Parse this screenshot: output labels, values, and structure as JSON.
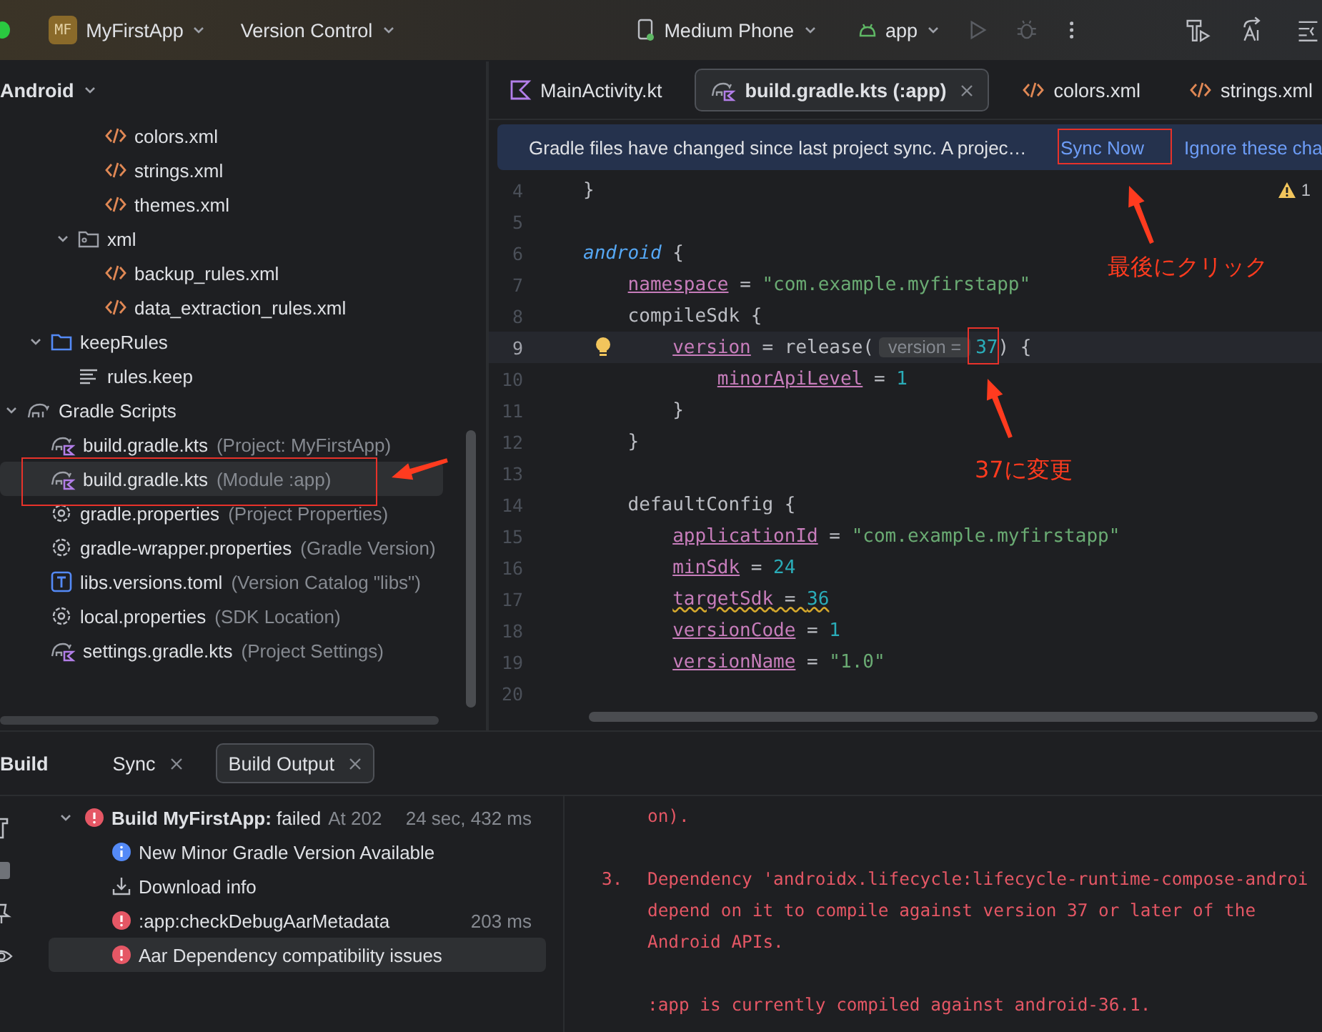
{
  "title_bar": {
    "project_badge": "MF",
    "project": "MyFirstApp",
    "vcs": "Version Control",
    "device": "Medium Phone",
    "config": "app"
  },
  "project_panel": {
    "view": "Android",
    "tree": [
      {
        "children": [
          {
            "children": [
              {
                "children": [
                  {
                    "label": "colors.xml",
                    "kind": "xml",
                    "selected": false
                  },
                  {
                    "label": "strings.xml",
                    "kind": "xml",
                    "selected": false
                  },
                  {
                    "label": "themes.xml",
                    "kind": "xml",
                    "selected": false
                  }
                ]
              },
              {
                "label": "xml",
                "kind": "res_folder",
                "expanded": true,
                "selected": false,
                "children": [
                  {
                    "label": "backup_rules.xml",
                    "kind": "xml",
                    "selected": false
                  },
                  {
                    "label": "data_extraction_rules.xml",
                    "kind": "xml",
                    "selected": false
                  }
                ]
              }
            ]
          },
          {
            "label": "keepRules",
            "kind": "folder",
            "expanded": true,
            "selected": false,
            "children": [
              {
                "label": "rules.keep",
                "kind": "text",
                "selected": false
              }
            ]
          }
        ]
      },
      {
        "label": "Gradle Scripts",
        "kind": "gradle",
        "expanded": true,
        "selected": false,
        "children": [
          {
            "label": "build.gradle.kts",
            "detail": "(Project: MyFirstApp)",
            "kind": "gradle_kts",
            "selected": false
          },
          {
            "label": "build.gradle.kts",
            "detail": "(Module :app)",
            "kind": "gradle_kts",
            "selected": true
          },
          {
            "label": "gradle.properties",
            "detail": "(Project Properties)",
            "kind": "settings",
            "selected": false
          },
          {
            "label": "gradle-wrapper.properties",
            "detail": "(Gradle Version)",
            "kind": "settings",
            "selected": false
          },
          {
            "label": "libs.versions.toml",
            "detail": "(Version Catalog \"libs\")",
            "kind": "toml",
            "selected": false
          },
          {
            "label": "local.properties",
            "detail": "(SDK Location)",
            "kind": "settings",
            "selected": false
          },
          {
            "label": "settings.gradle.kts",
            "detail": "(Project Settings)",
            "kind": "gradle_kts",
            "selected": false
          }
        ]
      }
    ]
  },
  "editor": {
    "tabs": [
      {
        "label": "MainActivity.kt",
        "kind": "kotlin",
        "selected": false
      },
      {
        "label": "build.gradle.kts (:app)",
        "kind": "gradle_kts",
        "selected": true
      },
      {
        "label": "colors.xml",
        "kind": "xml",
        "selected": false
      },
      {
        "label": "strings.xml",
        "kind": "xml",
        "selected": false
      }
    ],
    "banner": {
      "message": "Gradle files have changed since last project sync. A projec…",
      "actions": [
        "Sync Now",
        "Ignore these cha"
      ]
    },
    "warnings": "1",
    "lines": [
      {
        "number": "4",
        "current": false,
        "tokens": [
          {
            "kind": "plain",
            "text": "}"
          }
        ]
      },
      {
        "number": "5",
        "current": false
      },
      {
        "number": "6",
        "current": false,
        "tokens": [
          {
            "kind": "keyword",
            "text": "android"
          },
          {
            "kind": "plain",
            "text": " {"
          }
        ],
        "children": [
          {
            "number": "7",
            "current": false,
            "tokens": [
              {
                "kind": "prop",
                "text": "namespace"
              },
              {
                "kind": "plain",
                "text": " = "
              },
              {
                "kind": "string",
                "text": "\"com.example.myfirstapp\""
              }
            ]
          },
          {
            "number": "8",
            "current": false,
            "tokens": [
              {
                "kind": "plain",
                "text": "compileSdk {"
              }
            ],
            "children": [
              {
                "number": "9",
                "current": true,
                "tokens": [
                  {
                    "kind": "prop",
                    "text": "version"
                  },
                  {
                    "kind": "plain",
                    "text": " = release("
                  },
                  {
                    "kind": "hint",
                    "text": "version ="
                  },
                  {
                    "kind": "number",
                    "text": "37"
                  },
                  {
                    "kind": "plain",
                    "text": ") {"
                  }
                ],
                "children": [
                  {
                    "number": "10",
                    "current": false,
                    "tokens": [
                      {
                        "kind": "prop",
                        "text": "minorApiLevel"
                      },
                      {
                        "kind": "plain",
                        "text": " = "
                      },
                      {
                        "kind": "number",
                        "text": "1"
                      }
                    ]
                  }
                ]
              },
              {
                "number": "11",
                "current": false,
                "tokens": [
                  {
                    "kind": "plain",
                    "text": "}"
                  }
                ]
              }
            ]
          },
          {
            "number": "12",
            "current": false,
            "tokens": [
              {
                "kind": "plain",
                "text": "}"
              }
            ]
          },
          {
            "number": "13",
            "current": false
          },
          {
            "number": "14",
            "current": false,
            "tokens": [
              {
                "kind": "plain",
                "text": "defaultConfig {"
              }
            ],
            "children": [
              {
                "number": "15",
                "current": false,
                "tokens": [
                  {
                    "kind": "prop",
                    "text": "applicationId"
                  },
                  {
                    "kind": "plain",
                    "text": " = "
                  },
                  {
                    "kind": "string",
                    "text": "\"com.example.myfirstapp\""
                  }
                ]
              },
              {
                "number": "16",
                "current": false,
                "tokens": [
                  {
                    "kind": "prop",
                    "text": "minSdk"
                  },
                  {
                    "kind": "plain",
                    "text": " = "
                  },
                  {
                    "kind": "number",
                    "text": "24"
                  }
                ]
              },
              {
                "number": "17",
                "current": false,
                "tokens": [
                  {
                    "kind": "prop",
                    "text": "targetSdk",
                    "warning": true
                  },
                  {
                    "kind": "plain",
                    "text": " = ",
                    "warning": true
                  },
                  {
                    "kind": "number",
                    "text": "36",
                    "warning": true
                  }
                ]
              },
              {
                "number": "18",
                "current": false,
                "tokens": [
                  {
                    "kind": "prop",
                    "text": "versionCode"
                  },
                  {
                    "kind": "plain",
                    "text": " = "
                  },
                  {
                    "kind": "number",
                    "text": "1"
                  }
                ]
              },
              {
                "number": "19",
                "current": false,
                "tokens": [
                  {
                    "kind": "prop",
                    "text": "versionName"
                  },
                  {
                    "kind": "plain",
                    "text": " = "
                  },
                  {
                    "kind": "string",
                    "text": "\"1.0\""
                  }
                ]
              },
              {
                "number": "20",
                "current": false
              }
            ]
          }
        ]
      }
    ]
  },
  "build_panel": {
    "title": "Build",
    "tabs": [
      {
        "label": "Sync",
        "selected": false
      },
      {
        "label": "Build Output",
        "selected": true
      }
    ],
    "tree": [
      {
        "kind": "error",
        "label": "**Build MyFirstApp:** failed",
        "detail": "At 202",
        "time": "24 sec, 432 ms",
        "expanded": true,
        "selected": false,
        "children": [
          {
            "kind": "info",
            "label": "New Minor Gradle Version Available",
            "selected": false
          },
          {
            "kind": "download",
            "label": "Download info",
            "selected": false
          },
          {
            "kind": "error",
            "label": ":app:checkDebugAarMetadata",
            "time": "203 ms",
            "selected": false
          },
          {
            "kind": "error",
            "label": "Aar Dependency compatibility issues",
            "selected": true
          }
        ]
      }
    ],
    "output": [
      {
        "lines": [
          "on)."
        ]
      },
      {
        "number": "3.",
        "lines": [
          "Dependency 'androidx.lifecycle:lifecycle-runtime-compose-androi",
          "depend on it to compile against version 37 or later of the",
          "Android APIs."
        ]
      },
      {
        "lines": [
          ":app is currently compiled against android-36.1."
        ]
      }
    ]
  },
  "annotations": [
    {
      "text": "最後にクリック"
    },
    {
      "text": "37に変更"
    }
  ]
}
